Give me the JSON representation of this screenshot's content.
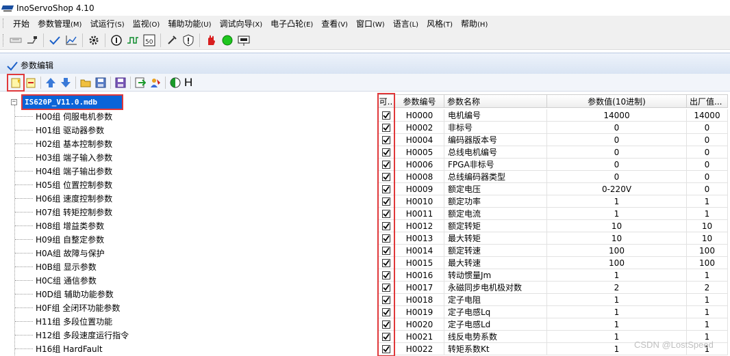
{
  "window": {
    "title": "InoServoShop 4.10"
  },
  "menu": [
    {
      "label": "开始",
      "acc": ""
    },
    {
      "label": "参数管理",
      "acc": "(M)"
    },
    {
      "label": "试运行",
      "acc": "(S)"
    },
    {
      "label": "监视",
      "acc": "(O)"
    },
    {
      "label": "辅助功能",
      "acc": "(U)"
    },
    {
      "label": "调试向导",
      "acc": "(X)"
    },
    {
      "label": "电子凸轮",
      "acc": "(E)"
    },
    {
      "label": "查看",
      "acc": "(V)"
    },
    {
      "label": "窗口",
      "acc": "(W)"
    },
    {
      "label": "语言",
      "acc": "(L)"
    },
    {
      "label": "风格",
      "acc": "(T)"
    },
    {
      "label": "帮助",
      "acc": "(H)"
    }
  ],
  "panel": {
    "title": "参数编辑",
    "h_label": "H"
  },
  "tree": {
    "root": "IS620P_V11.0.mdb",
    "expander": "−",
    "items": [
      "H00组 伺服电机参数",
      "H01组 驱动器参数",
      "H02组 基本控制参数",
      "H03组 端子输入参数",
      "H04组 端子输出参数",
      "H05组 位置控制参数",
      "H06组 速度控制参数",
      "H07组 转矩控制参数",
      "H08组 增益类参数",
      "H09组 自整定参数",
      "H0A组 故障与保护",
      "H0B组 显示参数",
      "H0C组 通信参数",
      "H0D组 辅助功能参数",
      "H0F组 全闭环功能参数",
      "H11组 多段位置功能",
      "H12组 多段速度运行指令",
      "H16组 HardFault"
    ]
  },
  "grid": {
    "headers": {
      "check": "可..",
      "code": "参数编号",
      "name": "参数名称",
      "value": "参数值(10进制)",
      "default": "出厂值..."
    },
    "rows": [
      {
        "code": "H0000",
        "name": "电机编号",
        "value": "14000",
        "default": "14000"
      },
      {
        "code": "H0002",
        "name": "非标号",
        "value": "0",
        "default": "0"
      },
      {
        "code": "H0004",
        "name": "编码器版本号",
        "value": "0",
        "default": "0"
      },
      {
        "code": "H0005",
        "name": "总线电机编号",
        "value": "0",
        "default": "0"
      },
      {
        "code": "H0006",
        "name": "FPGA非标号",
        "value": "0",
        "default": "0"
      },
      {
        "code": "H0008",
        "name": "总线编码器类型",
        "value": "0",
        "default": "0"
      },
      {
        "code": "H0009",
        "name": "额定电压",
        "value": "0-220V",
        "default": "0"
      },
      {
        "code": "H0010",
        "name": "额定功率",
        "value": "1",
        "default": "1"
      },
      {
        "code": "H0011",
        "name": "额定电流",
        "value": "1",
        "default": "1"
      },
      {
        "code": "H0012",
        "name": "额定转矩",
        "value": "10",
        "default": "10"
      },
      {
        "code": "H0013",
        "name": "最大转矩",
        "value": "10",
        "default": "10"
      },
      {
        "code": "H0014",
        "name": "额定转速",
        "value": "100",
        "default": "100"
      },
      {
        "code": "H0015",
        "name": "最大转速",
        "value": "100",
        "default": "100"
      },
      {
        "code": "H0016",
        "name": "转动惯量Jm",
        "value": "1",
        "default": "1"
      },
      {
        "code": "H0017",
        "name": "永磁同步电机极对数",
        "value": "2",
        "default": "2"
      },
      {
        "code": "H0018",
        "name": "定子电阻",
        "value": "1",
        "default": "1"
      },
      {
        "code": "H0019",
        "name": "定子电感Lq",
        "value": "1",
        "default": "1"
      },
      {
        "code": "H0020",
        "name": "定子电感Ld",
        "value": "1",
        "default": "1"
      },
      {
        "code": "H0021",
        "name": "线反电势系数",
        "value": "1",
        "default": "1"
      },
      {
        "code": "H0022",
        "name": "转矩系数Kt",
        "value": "1",
        "default": "1"
      }
    ]
  },
  "watermark": "CSDN @LostSpeed"
}
